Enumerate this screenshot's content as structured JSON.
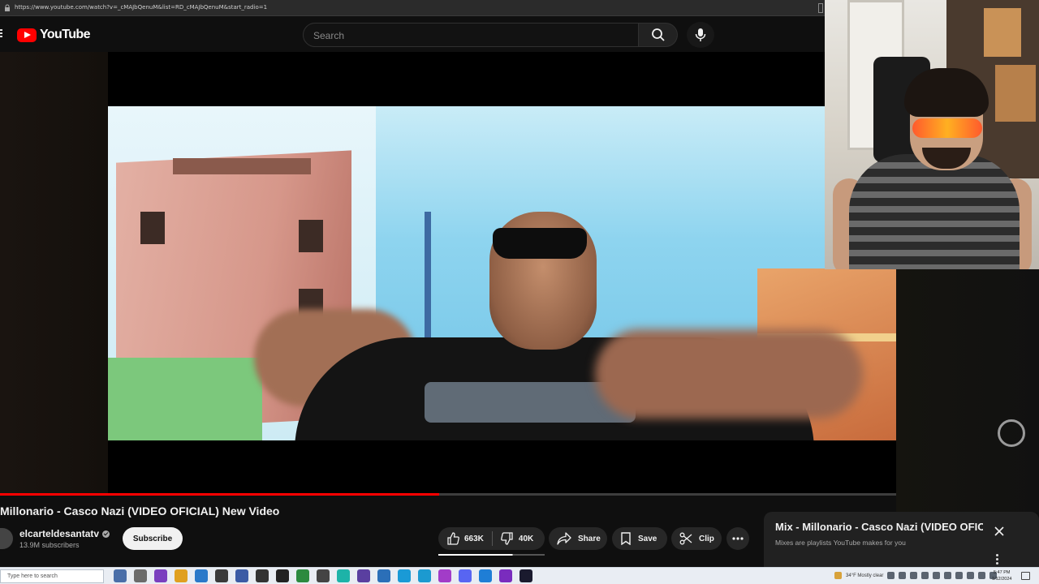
{
  "browser": {
    "url": "https://www.youtube.com/watch?v=_cMAJbQenuM&list=RD_cMAJbQenuM&start_radio=1"
  },
  "masthead": {
    "logo_text": "YouTube",
    "search_placeholder": "Search"
  },
  "video": {
    "title": "Millonario - Casco Nazi (VIDEO OFICIAL) New Video",
    "progress_fraction": 0.49
  },
  "channel": {
    "name": "elcarteldesantatv",
    "subscribers": "13.9M subscribers",
    "subscribe_label": "Subscribe"
  },
  "actions": {
    "likes": "663K",
    "dislikes": "40K",
    "share": "Share",
    "save": "Save",
    "clip": "Clip"
  },
  "mix_panel": {
    "title": "Mix - Millonario - Casco Nazi (VIDEO OFICIAL) New Video",
    "subtitle": "Mixes are playlists YouTube makes for you"
  },
  "taskbar": {
    "search_placeholder": "Type here to search",
    "weather": "34°F  Mostly clear",
    "time": "5:47 PM",
    "date": "1/12/2024"
  },
  "colors": {
    "youtube_red": "#ff0000",
    "background": "#0f0f0f",
    "pill": "#272727"
  },
  "icons": {
    "masthead": [
      "menu-icon",
      "youtube-logo-icon",
      "search-icon",
      "mic-icon"
    ],
    "actions": [
      "thumbs-up-icon",
      "thumbs-down-icon",
      "share-icon",
      "bookmark-icon",
      "scissors-icon",
      "more-icon"
    ],
    "mix": [
      "close-icon",
      "kebab-icon"
    ]
  }
}
